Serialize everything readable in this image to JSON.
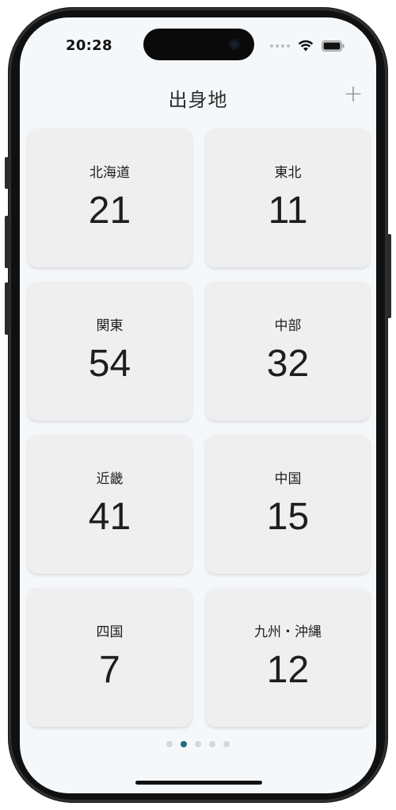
{
  "status_bar": {
    "time": "20:28"
  },
  "header": {
    "title": "出身地",
    "add_label": "+"
  },
  "regions": [
    {
      "name": "北海道",
      "count": "21"
    },
    {
      "name": "東北",
      "count": "11"
    },
    {
      "name": "関東",
      "count": "54"
    },
    {
      "name": "中部",
      "count": "32"
    },
    {
      "name": "近畿",
      "count": "41"
    },
    {
      "name": "中国",
      "count": "15"
    },
    {
      "name": "四国",
      "count": "7"
    },
    {
      "name": "九州・沖縄",
      "count": "12"
    }
  ],
  "pagination": {
    "total_pages": 5,
    "current_page": 2
  },
  "colors": {
    "active_dot": "#1f6a80",
    "card_background": "#efefef",
    "screen_background": "#f5f8fb"
  }
}
